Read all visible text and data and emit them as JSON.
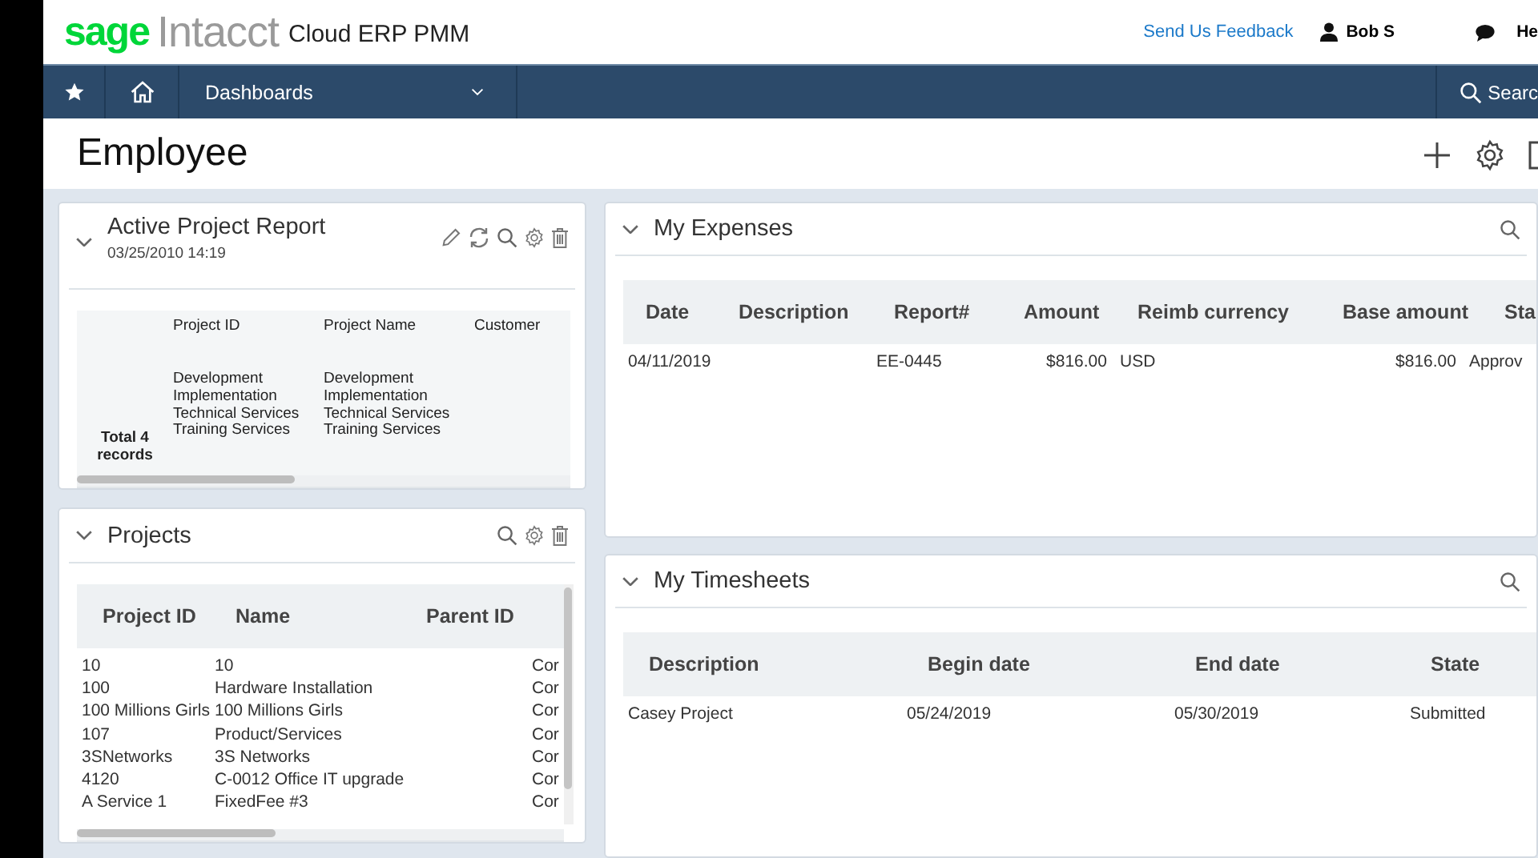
{
  "header": {
    "logo_brand": "sage",
    "logo_product": "Intacct",
    "app_name": "Cloud ERP PMM",
    "feedback_link": "Send Us Feedback",
    "user": "Bob S",
    "help": "He"
  },
  "nav": {
    "menu": "Dashboards",
    "search": "Searc"
  },
  "page": {
    "title": "Employee"
  },
  "cards": [
    {
      "kind": "report",
      "title": "Active Project Report",
      "timestamp": "03/25/2010 14:19",
      "expanded": true,
      "columns": [
        "",
        "Project ID",
        "Project Name",
        "Customer"
      ],
      "rows": [
        [
          "Total 4 records",
          [
            "Development",
            "Implementation",
            "Technical Services",
            "Training Services"
          ],
          [
            "Development",
            "Implementation",
            "Technical Services",
            "Training Services"
          ],
          null
        ]
      ]
    },
    {
      "kind": "list",
      "title": "Projects",
      "expanded": true,
      "columns": [
        "Project ID",
        "Name",
        "Parent ID"
      ],
      "rows": [
        [
          "10",
          "10",
          null,
          "Cor"
        ],
        [
          "100",
          "Hardware Installation",
          null,
          "Cor"
        ],
        [
          "100 Millions Girls",
          "100 Millions Girls",
          null,
          "Cor"
        ],
        [
          "107",
          "Product/Services",
          null,
          "Cor"
        ],
        [
          "3SNetworks",
          "3S Networks",
          null,
          "Cor"
        ],
        [
          "4120",
          "C-0012 Office IT upgrade",
          null,
          "Cor"
        ],
        [
          "A Service 1",
          "FixedFee #3",
          null,
          "Cor"
        ]
      ]
    },
    {
      "kind": "expenses",
      "title": "My Expenses",
      "expanded": true,
      "columns": [
        "Date",
        "Description",
        "Report#",
        "Amount",
        "Reimb currency",
        "Base amount",
        "Sta"
      ],
      "rows": [
        [
          "04/11/2019",
          null,
          "EE-0445",
          "$816.00",
          "USD",
          "$816.00",
          "Approv"
        ]
      ]
    },
    {
      "kind": "timesheets",
      "title": "My Timesheets",
      "expanded": true,
      "columns": [
        "Description",
        "Begin date",
        "End date",
        "State"
      ],
      "rows": [
        [
          "Casey Project",
          "05/24/2019",
          "05/30/2019",
          "Submitted"
        ]
      ]
    }
  ]
}
